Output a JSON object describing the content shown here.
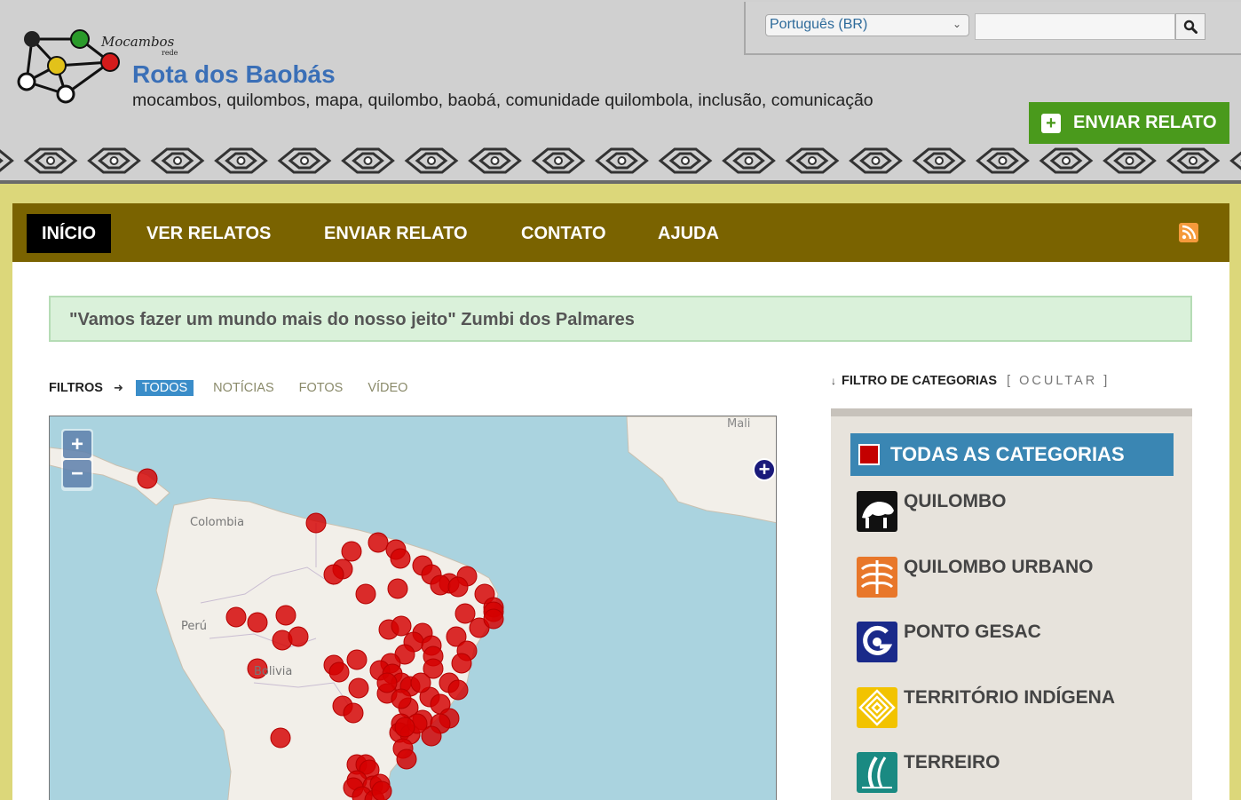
{
  "header": {
    "logo_text": "Mocambos rede",
    "title": "Rota dos Baobás",
    "tagline": "mocambos, quilombos, mapa, quilombo, baobá, comunidade quilombola, inclusão, comunicação",
    "language": "Português (BR)",
    "search_placeholder": "",
    "send_button": "ENVIAR RELATO"
  },
  "nav": {
    "items": [
      "INÍCIO",
      "VER RELATOS",
      "ENVIAR RELATO",
      "CONTATO",
      "AJUDA"
    ],
    "active": "INÍCIO",
    "rss_icon": "rss-icon"
  },
  "quote": "\"Vamos fazer um mundo mais do nosso jeito\" Zumbi dos Palmares",
  "filters": {
    "label": "FILTROS",
    "tabs": [
      "TODOS",
      "NOTÍCIAS",
      "FOTOS",
      "VÍDEO"
    ],
    "active": "TODOS"
  },
  "map": {
    "labels": [
      "Mali",
      "Colombia",
      "Perú",
      "Bolivia"
    ],
    "zoom_in": "+",
    "zoom_out": "−",
    "marker_color": "#d40000"
  },
  "categories": {
    "header_label": "FILTRO DE CATEGORIAS",
    "toggle": "[ OCULTAR ]",
    "all": "TODAS AS CATEGORIAS",
    "items": [
      "QUILOMBO",
      "QUILOMBO URBANO",
      "PONTO GESAC",
      "TERRITÓRIO INDÍGENA",
      "TERREIRO"
    ]
  }
}
